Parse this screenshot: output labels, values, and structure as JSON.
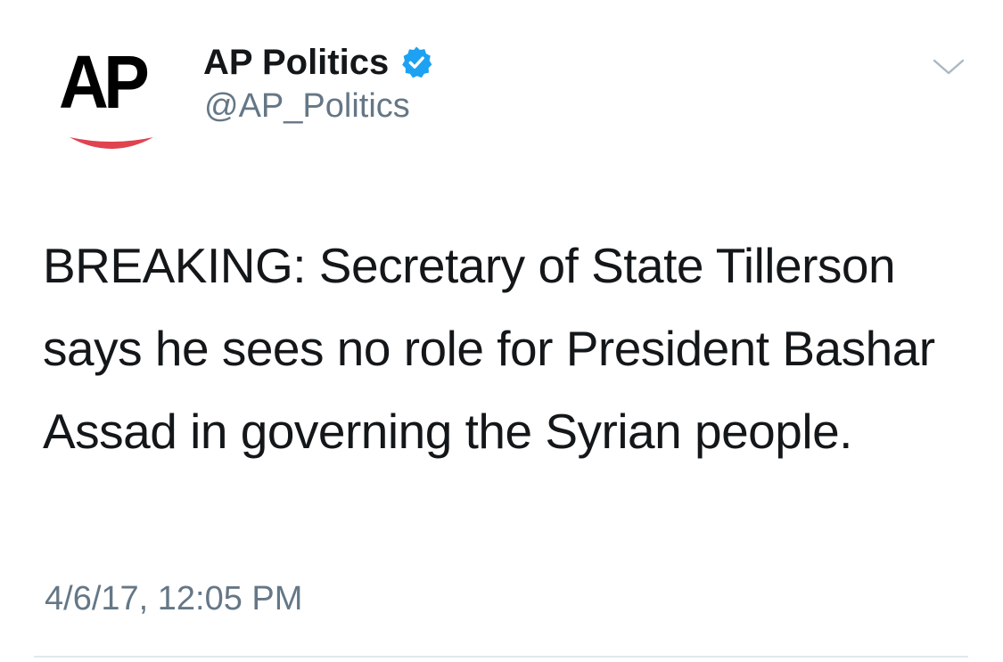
{
  "profile": {
    "avatar_logo_text": "AP",
    "display_name": "AP Politics",
    "handle": "@AP_Politics",
    "verified": true
  },
  "tweet": {
    "text": "BREAKING: Secretary of State Tillerson says he sees no role for President Bashar Assad in governing the Syrian people.",
    "timestamp": "4/6/17, 12:05 PM"
  },
  "icons": {
    "verified": "verified-badge-icon",
    "menu": "chevron-down-icon"
  },
  "colors": {
    "verified_blue": "#1da1f2",
    "handle_gray": "#657786",
    "text": "#14171a",
    "ap_red": "#e0434f",
    "divider": "#e1e8ed"
  }
}
